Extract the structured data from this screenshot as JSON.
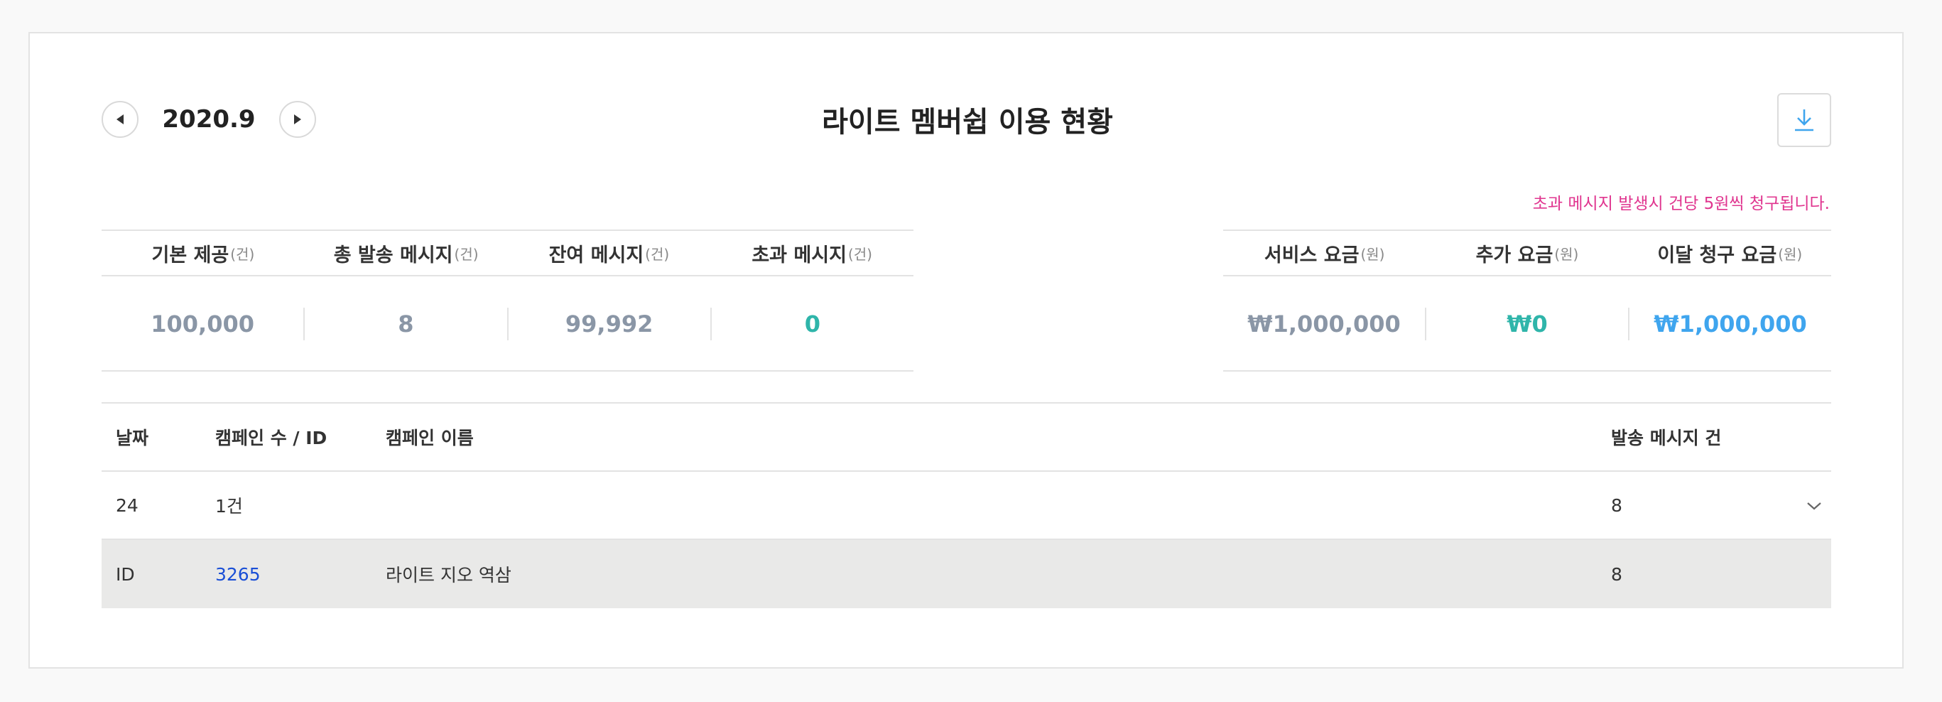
{
  "header": {
    "month": "2020.9",
    "title": "라이트 멤버쉽 이용 현황",
    "prev_icon": "triangle-left-icon",
    "next_icon": "triangle-right-icon",
    "download_icon": "download-icon"
  },
  "notice": "초과 메시지 발생시 건당 5원씩 청구됩니다.",
  "message_stats": {
    "headers": [
      {
        "label": "기본 제공",
        "unit": "(건)"
      },
      {
        "label": "총 발송 메시지",
        "unit": "(건)"
      },
      {
        "label": "잔여 메시지",
        "unit": "(건)"
      },
      {
        "label": "초과 메시지",
        "unit": "(건)"
      }
    ],
    "values": [
      "100,000",
      "8",
      "99,992",
      "0"
    ]
  },
  "fee_stats": {
    "headers": [
      {
        "label": "서비스 요금",
        "unit": "(원)"
      },
      {
        "label": "추가 요금",
        "unit": "(원)"
      },
      {
        "label": "이달 청구 요금",
        "unit": "(원)"
      }
    ],
    "values": [
      "₩1,000,000",
      "₩0",
      "₩1,000,000"
    ]
  },
  "campaign_table": {
    "columns": [
      "날짜",
      "캠페인 수 / ID",
      "캠페인 이름",
      "발송 메시지 건"
    ],
    "summary_row": {
      "date": "24",
      "count": "1건",
      "name": "",
      "sent": "8"
    },
    "detail_row": {
      "label": "ID",
      "id": "3265",
      "name": "라이트 지오 역삼",
      "sent": "8"
    },
    "expand_icon": "chevron-down-icon"
  },
  "colors": {
    "accent_teal": "#2fb5aa",
    "accent_blue": "#3fa5ee",
    "notice_pink": "#e0358f",
    "link_blue": "#1a4fd6"
  }
}
